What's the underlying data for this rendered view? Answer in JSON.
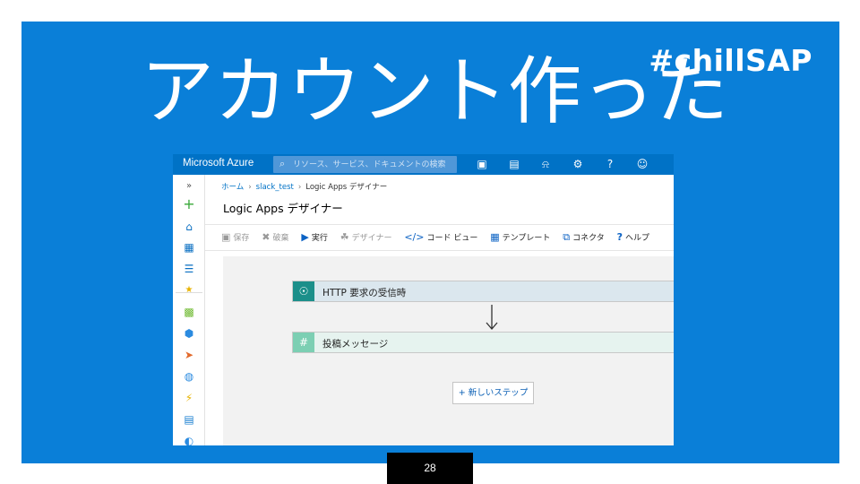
{
  "slide": {
    "hashtag": "#chillSAP",
    "title": "アカウント作った",
    "page_number": "28"
  },
  "azure": {
    "brand": "Microsoft Azure",
    "search_placeholder": "リソース、サービス、ドキュメントの検索",
    "topbar_icons": [
      "terminal-icon",
      "directory-filter-icon",
      "bell-icon",
      "gear-icon",
      "help-icon",
      "smiley-icon"
    ],
    "breadcrumb": [
      "ホーム",
      "slack_test",
      "Logic Apps デザイナー"
    ],
    "page_title": "Logic Apps デザイナー",
    "toolbar": {
      "save": "保存",
      "discard": "破棄",
      "run": "実行",
      "designer": "デザイナー",
      "code_view": "コード ビュー",
      "templates": "テンプレート",
      "connectors": "コネクタ",
      "help": "ヘルプ"
    },
    "steps": [
      {
        "label": "HTTP 要求の受信時",
        "icon": "http-request-icon"
      },
      {
        "label": "投稿メッセージ",
        "icon": "slack-icon"
      }
    ],
    "new_step": "+ 新しいステップ",
    "colors": {
      "slide_blue": "#0a7fd8",
      "azure_topbar": "#0072c6",
      "http_step": "#1b8f8a",
      "slack_step": "#7ccfb3"
    }
  }
}
